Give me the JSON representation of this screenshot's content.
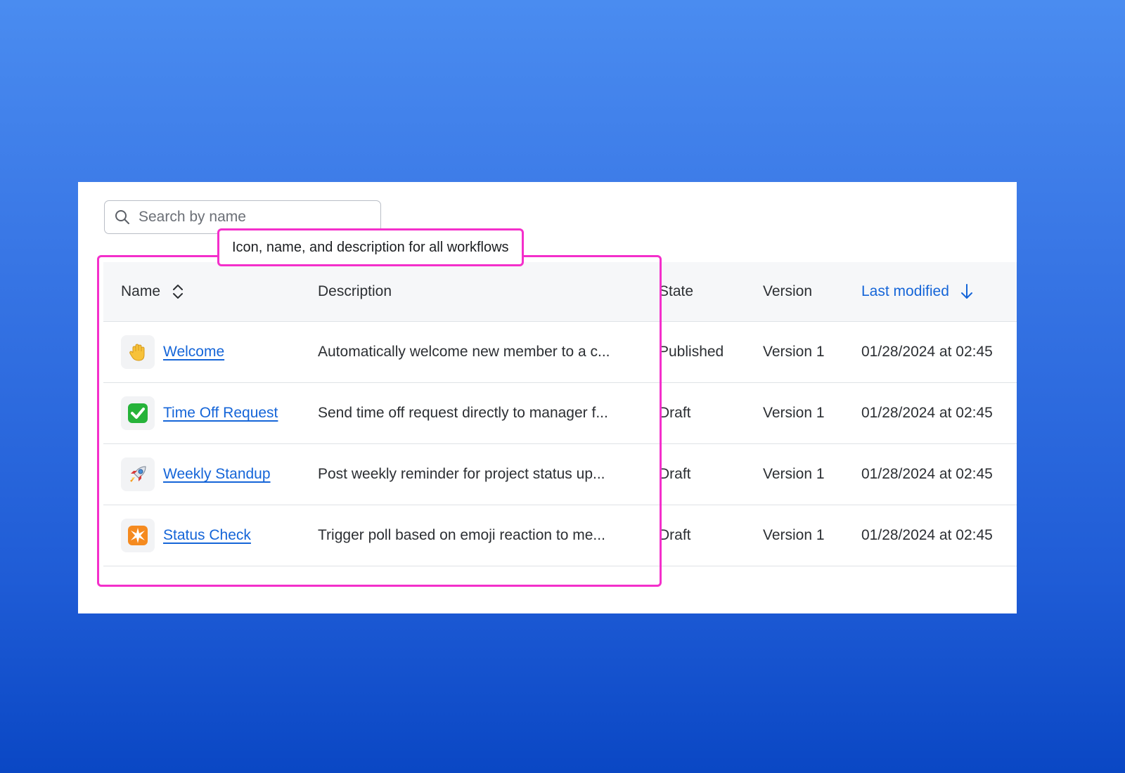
{
  "search": {
    "placeholder": "Search by name",
    "icon": "search-icon"
  },
  "table": {
    "columns": {
      "name": "Name",
      "description": "Description",
      "state": "State",
      "version": "Version",
      "last_modified": "Last modified"
    },
    "sorted_column_color": "#1565d8",
    "rows": [
      {
        "icon": "waving-hand-icon",
        "name": "Welcome",
        "description": "Automatically welcome new member to a c...",
        "state": "Published",
        "version": "Version 1",
        "modified": "01/28/2024 at 02:45"
      },
      {
        "icon": "check-mark-icon",
        "name": "Time Off Request",
        "description": "Send time off request directly to manager f...",
        "state": "Draft",
        "version": "Version 1",
        "modified": "01/28/2024 at 02:45"
      },
      {
        "icon": "rocket-icon",
        "name": "Weekly Standup",
        "description": "Post weekly reminder for project status up...",
        "state": "Draft",
        "version": "Version 1",
        "modified": "01/28/2024 at 02:45"
      },
      {
        "icon": "sparkle-icon",
        "name": "Status Check",
        "description": "Trigger poll based on emoji reaction to me...",
        "state": "Draft",
        "version": "Version 1",
        "modified": "01/28/2024 at 02:45"
      }
    ]
  },
  "annotation": {
    "label": "Icon, name, and description for all workflows",
    "color": "#f42fcb"
  }
}
